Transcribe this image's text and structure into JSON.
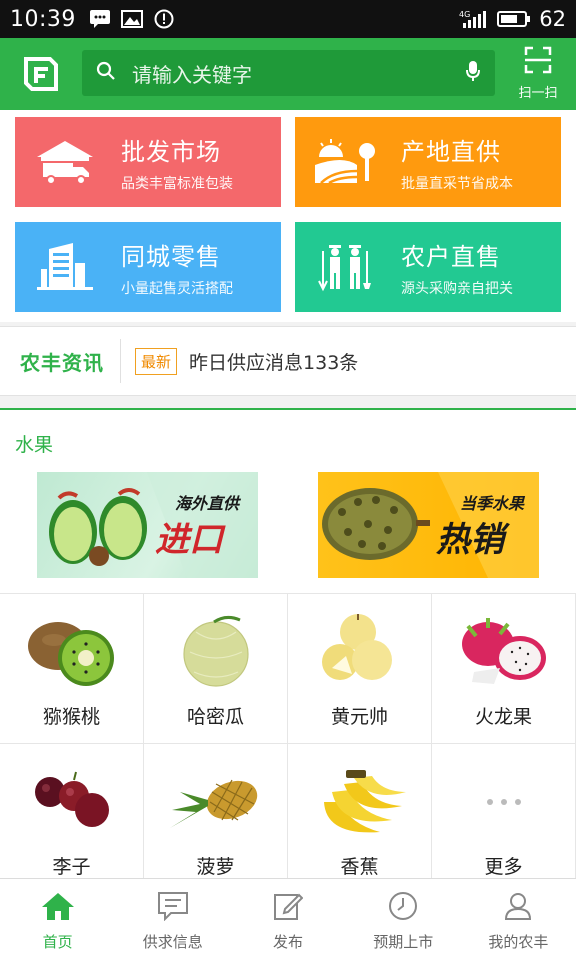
{
  "status_bar": {
    "time": "10:39",
    "network": "4G",
    "battery": "62"
  },
  "header": {
    "search_placeholder": "请输入关键字",
    "scan_label": "扫一扫"
  },
  "tiles": [
    {
      "title": "批发市场",
      "subtitle": "品类丰富标准包装",
      "color": "#f4686b",
      "icon": "truck-warehouse-icon"
    },
    {
      "title": "产地直供",
      "subtitle": "批量直采节省成本",
      "color": "#ff9a0e",
      "icon": "farm-field-icon"
    },
    {
      "title": "同城零售",
      "subtitle": "小量起售灵活搭配",
      "color": "#4ab2f6",
      "icon": "city-building-icon"
    },
    {
      "title": "农户直售",
      "subtitle": "源头采购亲自把关",
      "color": "#22c992",
      "icon": "farmers-icon"
    }
  ],
  "news": {
    "brand": "农丰资讯",
    "badge": "最新",
    "message": "昨日供应消息133条"
  },
  "fruit": {
    "title": "水果",
    "banners": [
      {
        "tag_small": "海外直供",
        "tag_big": "进口"
      },
      {
        "tag_small": "当季水果",
        "tag_big": "热销"
      }
    ],
    "items": [
      "猕猴桃",
      "哈密瓜",
      "黄元帅",
      "火龙果",
      "李子",
      "菠萝",
      "香蕉",
      "更多"
    ]
  },
  "tabbar": [
    {
      "label": "首页",
      "icon": "home-icon",
      "active": true
    },
    {
      "label": "供求信息",
      "icon": "message-icon",
      "active": false
    },
    {
      "label": "发布",
      "icon": "edit-icon",
      "active": false
    },
    {
      "label": "预期上市",
      "icon": "clock-icon",
      "active": false
    },
    {
      "label": "我的农丰",
      "icon": "user-icon",
      "active": false
    }
  ],
  "colors": {
    "primary": "#2fb24a",
    "news_badge": "#f08a00"
  }
}
